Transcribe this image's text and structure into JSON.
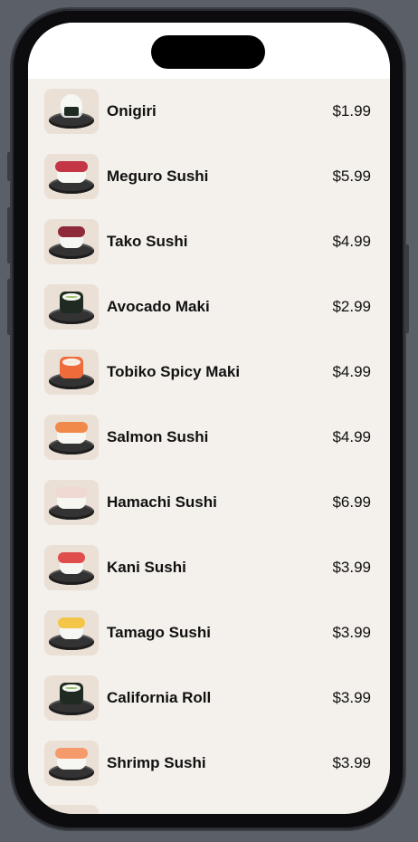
{
  "menu": {
    "items": [
      {
        "name": "Onigiri",
        "price": "$1.99",
        "icon": "onigiri-icon"
      },
      {
        "name": "Meguro Sushi",
        "price": "$5.99",
        "icon": "meguro-sushi-icon"
      },
      {
        "name": "Tako Sushi",
        "price": "$4.99",
        "icon": "tako-sushi-icon"
      },
      {
        "name": "Avocado Maki",
        "price": "$2.99",
        "icon": "avocado-maki-icon"
      },
      {
        "name": "Tobiko Spicy Maki",
        "price": "$4.99",
        "icon": "tobiko-spicy-maki-icon"
      },
      {
        "name": "Salmon Sushi",
        "price": "$4.99",
        "icon": "salmon-sushi-icon"
      },
      {
        "name": "Hamachi Sushi",
        "price": "$6.99",
        "icon": "hamachi-sushi-icon"
      },
      {
        "name": "Kani Sushi",
        "price": "$3.99",
        "icon": "kani-sushi-icon"
      },
      {
        "name": "Tamago Sushi",
        "price": "$3.99",
        "icon": "tamago-sushi-icon"
      },
      {
        "name": "California Roll",
        "price": "$3.99",
        "icon": "california-roll-icon"
      },
      {
        "name": "Shrimp Sushi",
        "price": "$3.99",
        "icon": "shrimp-sushi-icon"
      }
    ]
  },
  "colors": {
    "background": "#5b6068",
    "screen": "#f4f0eb",
    "thumbnail": "#eae0d6",
    "text": "#111111"
  }
}
